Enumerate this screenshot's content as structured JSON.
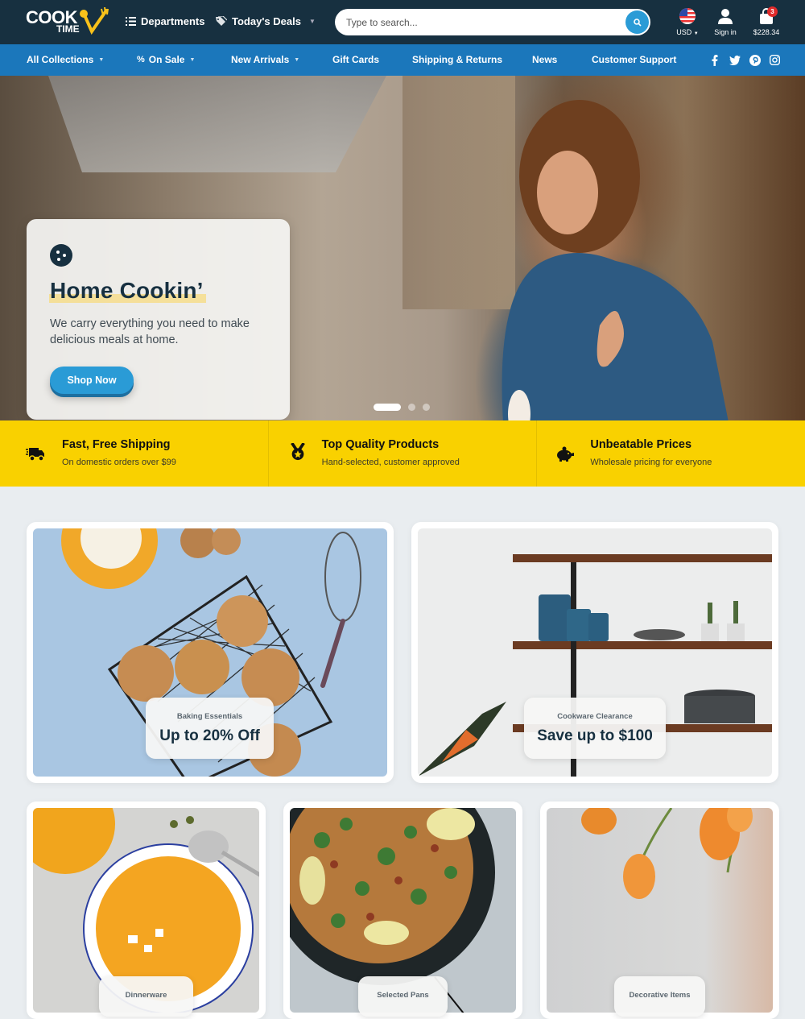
{
  "header": {
    "logo_text_top": "COOK",
    "logo_text_bottom": "TIME",
    "departments_label": "Departments",
    "deals_label": "Today's Deals",
    "search_placeholder": "Type to search...",
    "currency_label": "USD",
    "signin_label": "Sign in",
    "cart_total": "$228.34",
    "cart_count": "3"
  },
  "nav": {
    "items": [
      {
        "label": "All Collections",
        "dropdown": true
      },
      {
        "label": "On Sale",
        "dropdown": true,
        "icon": "percent-icon"
      },
      {
        "label": "New Arrivals",
        "dropdown": true
      },
      {
        "label": "Gift Cards"
      },
      {
        "label": "Shipping & Returns"
      },
      {
        "label": "News"
      },
      {
        "label": "Customer Support"
      }
    ],
    "social": [
      "facebook-icon",
      "twitter-icon",
      "pinterest-icon",
      "instagram-icon"
    ]
  },
  "hero": {
    "title": "Home Cookin’",
    "description": "We carry everything you need to make delicious meals at home.",
    "cta_label": "Shop Now",
    "slides_total": 3,
    "active_slide": 1
  },
  "features": [
    {
      "icon": "truck-icon",
      "title": "Fast, Free Shipping",
      "subtitle": "On domestic orders over $99"
    },
    {
      "icon": "medal-icon",
      "title": "Top Quality Products",
      "subtitle": "Hand-selected, customer approved"
    },
    {
      "icon": "piggy-bank-icon",
      "title": "Unbeatable Prices",
      "subtitle": "Wholesale pricing for everyone"
    }
  ],
  "promos": [
    {
      "kicker": "Baking Essentials",
      "headline": "Up to 20% Off"
    },
    {
      "kicker": "Cookware Clearance",
      "headline": "Save up to $100"
    }
  ],
  "categories": [
    {
      "label": "Dinnerware"
    },
    {
      "label": "Selected Pans"
    },
    {
      "label": "Decorative Items"
    }
  ],
  "colors": {
    "topbar": "#173040",
    "navbar": "#1b77bb",
    "accent": "#2a9bd6",
    "features_bg": "#f9d100",
    "badge": "#e02b2b"
  }
}
